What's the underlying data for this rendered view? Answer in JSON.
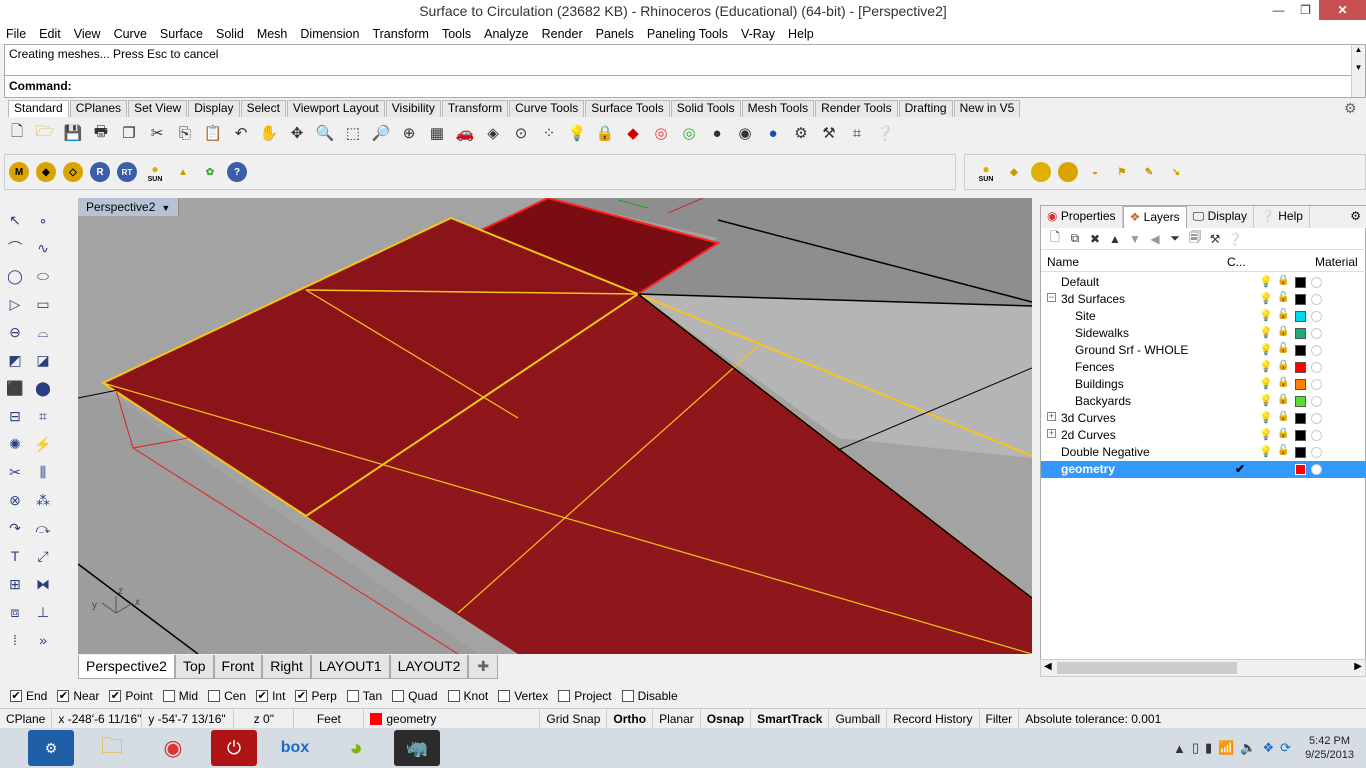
{
  "window": {
    "title": "Surface to Circulation (23682 KB) - Rhinoceros (Educational) (64-bit) - [Perspective2]",
    "min": "—",
    "max": "❐",
    "close": "✕"
  },
  "menu": [
    "File",
    "Edit",
    "View",
    "Curve",
    "Surface",
    "Solid",
    "Mesh",
    "Dimension",
    "Transform",
    "Tools",
    "Analyze",
    "Render",
    "Panels",
    "Paneling Tools",
    "V-Ray",
    "Help"
  ],
  "command": {
    "history": "Creating meshes... Press Esc to cancel",
    "prompt": "Command:"
  },
  "toolbar_tabs": [
    "Standard",
    "CPlanes",
    "Set View",
    "Display",
    "Select",
    "Viewport Layout",
    "Visibility",
    "Transform",
    "Curve Tools",
    "Surface Tools",
    "Solid Tools",
    "Mesh Tools",
    "Render Tools",
    "Drafting",
    "New in V5"
  ],
  "vray_toolbar": {
    "m": "M",
    "r": "R",
    "rt": "RT",
    "sun": "SUN",
    "help": "?"
  },
  "vray_toolbar_right": {
    "sun": "SUN"
  },
  "viewport": {
    "name": "Perspective2",
    "axes": {
      "x": "x",
      "y": "y",
      "z": "z"
    }
  },
  "viewport_tabs": [
    "Perspective2",
    "Top",
    "Front",
    "Right",
    "LAYOUT1",
    "LAYOUT2"
  ],
  "viewport_add": "✚",
  "panel": {
    "tabs": [
      "Properties",
      "Layers",
      "Display",
      "Help"
    ],
    "headers": {
      "name": "Name",
      "current": "C...",
      "material": "Material"
    }
  },
  "layers": [
    {
      "name": "Default",
      "indent": 0,
      "expand": "",
      "color": "#000000",
      "bulb_lit": false,
      "locked": true
    },
    {
      "name": "3d Surfaces",
      "indent": 0,
      "expand": "−",
      "color": "#000000",
      "bulb_lit": true,
      "locked": false
    },
    {
      "name": "Site",
      "indent": 1,
      "expand": "",
      "color": "#00d8e8",
      "bulb_lit": false,
      "locked": false
    },
    {
      "name": "Sidewalks",
      "indent": 1,
      "expand": "",
      "color": "#1faa73",
      "bulb_lit": false,
      "locked": true
    },
    {
      "name": "Ground Srf - WHOLE",
      "indent": 1,
      "expand": "",
      "color": "#000000",
      "bulb_lit": false,
      "locked": false
    },
    {
      "name": "Fences",
      "indent": 1,
      "expand": "",
      "color": "#ff0000",
      "bulb_lit": false,
      "locked": true
    },
    {
      "name": "Buildings",
      "indent": 1,
      "expand": "",
      "color": "#ff8000",
      "bulb_lit": false,
      "locked": true
    },
    {
      "name": "Backyards",
      "indent": 1,
      "expand": "",
      "color": "#55e02a",
      "bulb_lit": false,
      "locked": true
    },
    {
      "name": "3d Curves",
      "indent": 0,
      "expand": "+",
      "color": "#000000",
      "bulb_lit": false,
      "locked": true
    },
    {
      "name": "2d Curves",
      "indent": 0,
      "expand": "+",
      "color": "#000000",
      "bulb_lit": false,
      "locked": true
    },
    {
      "name": "Double Negative",
      "indent": 0,
      "expand": "",
      "color": "#000000",
      "bulb_lit": true,
      "locked": false
    },
    {
      "name": "geometry",
      "indent": 0,
      "expand": "",
      "color": "#ff0000",
      "bulb_lit": false,
      "locked": false,
      "selected": true,
      "current": "✔"
    }
  ],
  "osnaps": [
    {
      "label": "End",
      "checked": true
    },
    {
      "label": "Near",
      "checked": true
    },
    {
      "label": "Point",
      "checked": true
    },
    {
      "label": "Mid",
      "checked": false
    },
    {
      "label": "Cen",
      "checked": false
    },
    {
      "label": "Int",
      "checked": true
    },
    {
      "label": "Perp",
      "checked": true
    },
    {
      "label": "Tan",
      "checked": false
    },
    {
      "label": "Quad",
      "checked": false
    },
    {
      "label": "Knot",
      "checked": false
    },
    {
      "label": "Vertex",
      "checked": false
    },
    {
      "label": "Project",
      "checked": false
    },
    {
      "label": "Disable",
      "checked": false
    }
  ],
  "status": {
    "cplane": "CPlane",
    "x": "x -248'-6 11/16\"",
    "y": "y -54'-7 13/16\"",
    "z": "z 0\"",
    "units": "Feet",
    "layer": "geometry",
    "layer_color": "#ff0000",
    "grid_snap": "Grid Snap",
    "ortho": "Ortho",
    "planar": "Planar",
    "osnap": "Osnap",
    "smarttrack": "SmartTrack",
    "gumball": "Gumball",
    "record_history": "Record History",
    "filter": "Filter",
    "tolerance": "Absolute tolerance: 0.001"
  },
  "taskbar": {
    "apps": [
      "outlook",
      "file-explorer",
      "chrome",
      "power",
      "box",
      "spotify",
      "rhino"
    ],
    "box_label": "box",
    "time": "5:42 PM",
    "date": "9/25/2013"
  }
}
